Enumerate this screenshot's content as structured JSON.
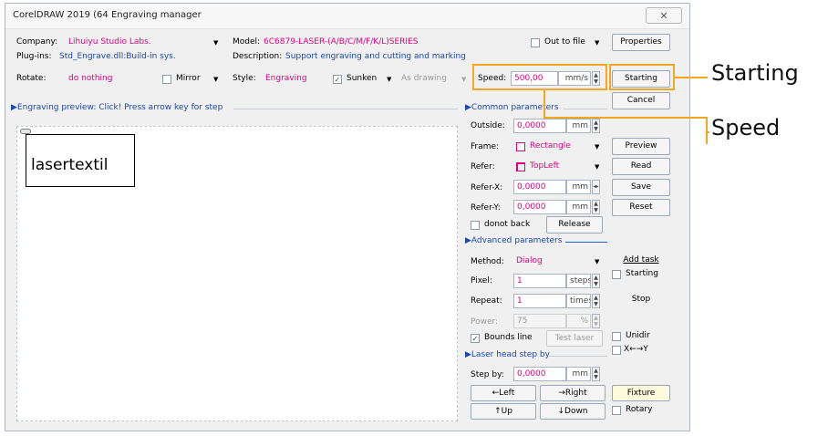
{
  "window": {
    "title": "CorelDRAW 2019 (64 Engraving manager",
    "close_glyph": "✕"
  },
  "top": {
    "company_label": "Company:",
    "company_value": "Lihuiyu Studio Labs.",
    "model_label": "Model:",
    "model_value": "6C6879-LASER-(A/B/C/M/F/K/L)SERIES",
    "out_to_file_label": "Out to file",
    "properties_button": "Properties",
    "plugins_label": "Plug-ins:",
    "plugins_value": "Std_Engrave.dll:Build-in sys.",
    "description_label": "Description:",
    "description_value": "Support engraving and cutting and marking",
    "rotate_label": "Rotate:",
    "rotate_value": "do nothing",
    "mirror_label": "Mirror",
    "style_label": "Style:",
    "style_value": "Engraving",
    "sunken_label": "Sunken",
    "as_drawing_value": "As drawing",
    "speed_label": "Speed:",
    "speed_value": "500,00",
    "speed_unit": "mm/s",
    "starting_button": "Starting",
    "cancel_button": "Cancel"
  },
  "preview": {
    "header": "Engraving preview: Click! Press arrow key for step",
    "object_text": "lasertextil"
  },
  "common": {
    "header": "Common parameters",
    "outside_label": "Outside:",
    "outside_value": "0,0000",
    "outside_unit": "mm",
    "frame_label": "Frame:",
    "frame_value": "Rectangle",
    "preview_button": "Preview",
    "refer_label": "Refer:",
    "refer_value": "TopLeft",
    "read_button": "Read",
    "referx_label": "Refer-X:",
    "referx_value": "0,0000",
    "referx_unit": "mm",
    "save_button": "Save",
    "refery_label": "Refer-Y:",
    "refery_value": "0,0000",
    "refery_unit": "mm",
    "reset_button": "Reset",
    "donot_back_label": "donot back",
    "release_button": "Release"
  },
  "advanced": {
    "header": "Advanced parameters",
    "method_label": "Method:",
    "method_value": "Dialog",
    "add_task_button": "Add task",
    "pixel_label": "Pixel:",
    "pixel_value": "1",
    "pixel_unit": "steps",
    "starting_check_label": "Starting",
    "repeat_label": "Repeat:",
    "repeat_value": "1",
    "repeat_unit": "times",
    "stop_button": "Stop",
    "power_label": "Power:",
    "power_value": "75",
    "power_unit": "%",
    "bounds_line_label": "Bounds line",
    "test_laser_button": "Test laser",
    "unidir_label": "Unidir",
    "xy_label": "X←→Y"
  },
  "laser_head": {
    "header": "Laser head step by",
    "stepby_label": "Step by:",
    "stepby_value": "0,0000",
    "stepby_unit": "mm",
    "left_button": "←Left",
    "right_button": "→Right",
    "fixture_button": "Fixture",
    "up_button": "↑Up",
    "down_button": "↓Down",
    "rotary_label": "Rotary"
  },
  "annotations": {
    "starting": "Starting",
    "speed": "Speed"
  },
  "colors": {
    "accent_pink": "#e0007e",
    "link_blue": "#1b47b0",
    "highlight": "#f5a623"
  }
}
